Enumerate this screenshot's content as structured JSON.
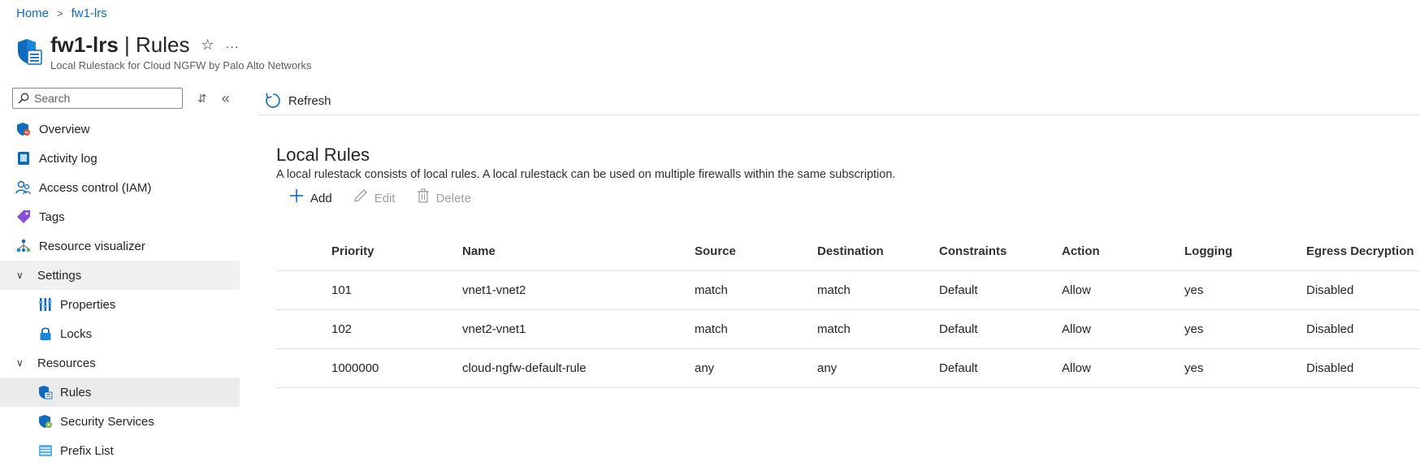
{
  "breadcrumb": {
    "home": "Home",
    "sep": ">",
    "current": "fw1-lrs"
  },
  "header": {
    "resource": "fw1-lrs",
    "separator": " | ",
    "page": "Rules",
    "subtitle": "Local Rulestack for Cloud NGFW by Palo Alto Networks",
    "star_icon": "☆",
    "more_icon": "···"
  },
  "sidebar": {
    "search_placeholder": "Search",
    "items": [
      {
        "label": "Overview",
        "icon": "overview-icon"
      },
      {
        "label": "Activity log",
        "icon": "activity-log-icon"
      },
      {
        "label": "Access control (IAM)",
        "icon": "iam-icon"
      },
      {
        "label": "Tags",
        "icon": "tag-icon"
      },
      {
        "label": "Resource visualizer",
        "icon": "resource-visualizer-icon"
      }
    ],
    "settings_group": "Settings",
    "settings_items": [
      {
        "label": "Properties",
        "icon": "properties-icon"
      },
      {
        "label": "Locks",
        "icon": "lock-icon"
      }
    ],
    "resources_group": "Resources",
    "resources_items": [
      {
        "label": "Rules",
        "icon": "rules-icon"
      },
      {
        "label": "Security Services",
        "icon": "security-services-icon"
      },
      {
        "label": "Prefix List",
        "icon": "prefix-list-icon"
      }
    ]
  },
  "command_bar": {
    "refresh_label": "Refresh"
  },
  "section": {
    "title": "Local Rules",
    "description": "A local rulestack consists of local rules. A local rulestack can be used on multiple firewalls within the same subscription."
  },
  "actions": {
    "add": "Add",
    "edit": "Edit",
    "delete": "Delete"
  },
  "table": {
    "columns": [
      "Priority",
      "Name",
      "Source",
      "Destination",
      "Constraints",
      "Action",
      "Logging",
      "Egress Decryption"
    ],
    "rows": [
      {
        "priority": "101",
        "name": "vnet1-vnet2",
        "source": "match",
        "destination": "match",
        "constraints": "Default",
        "action": "Allow",
        "logging": "yes",
        "egress": "Disabled"
      },
      {
        "priority": "102",
        "name": "vnet2-vnet1",
        "source": "match",
        "destination": "match",
        "constraints": "Default",
        "action": "Allow",
        "logging": "yes",
        "egress": "Disabled"
      },
      {
        "priority": "1000000",
        "name": "cloud-ngfw-default-rule",
        "source": "any",
        "destination": "any",
        "constraints": "Default",
        "action": "Allow",
        "logging": "yes",
        "egress": "Disabled"
      }
    ]
  },
  "colors": {
    "link": "#0f6cbd",
    "selected_bg": "#ebebeb",
    "group_bg": "#f0f0f0",
    "disabled": "#a19f9d"
  }
}
